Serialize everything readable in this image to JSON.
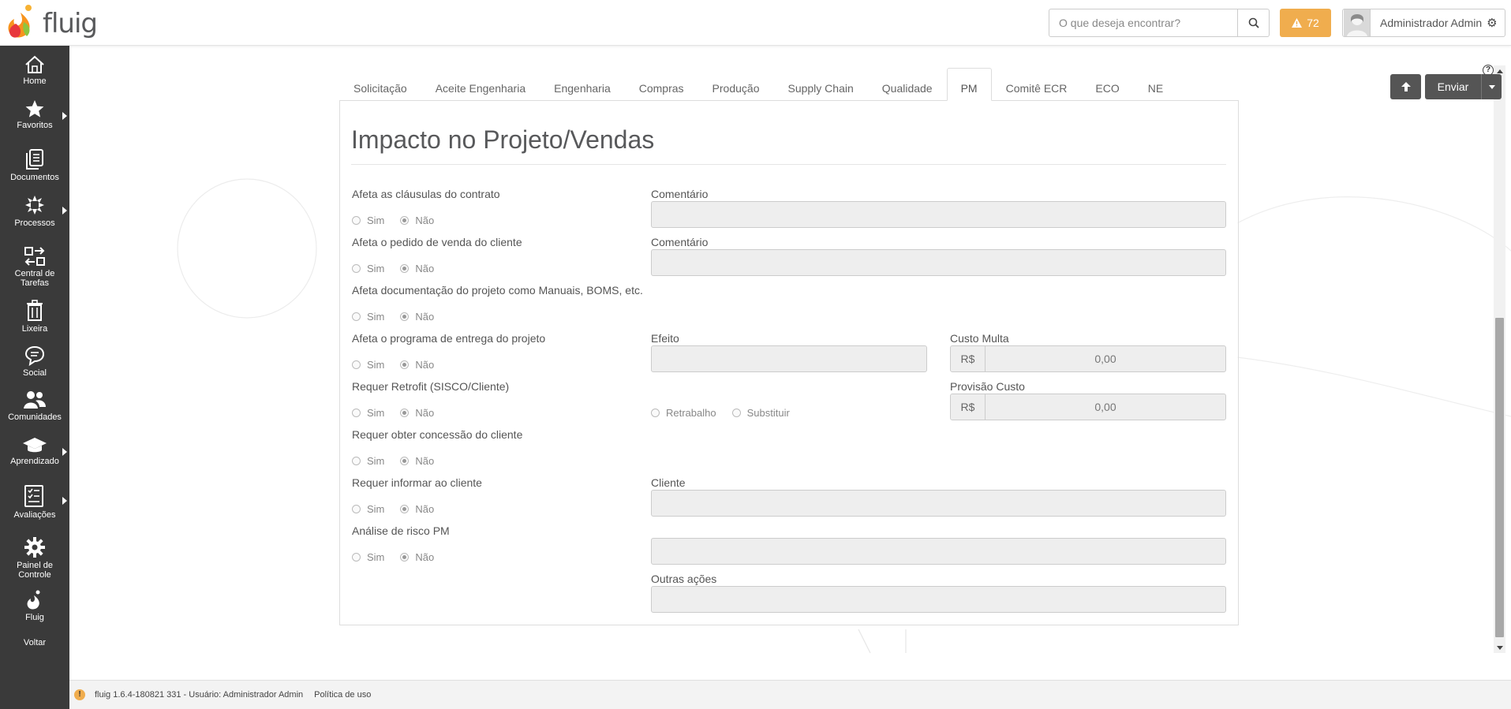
{
  "header": {
    "logo_text": "fluig",
    "search_placeholder": "O que deseja encontrar?",
    "alerts_count": "72",
    "user_name": "Administrador Admin"
  },
  "sidebar": {
    "items": [
      {
        "label": "Home",
        "icon": "home-icon"
      },
      {
        "label": "Favoritos",
        "icon": "star-icon"
      },
      {
        "label": "Documentos",
        "icon": "documents-icon"
      },
      {
        "label": "Processos",
        "icon": "processes-icon"
      },
      {
        "label": "Central de Tarefas",
        "icon": "tasks-icon"
      },
      {
        "label": "Lixeira",
        "icon": "trash-icon"
      },
      {
        "label": "Social",
        "icon": "social-icon"
      },
      {
        "label": "Comunidades",
        "icon": "communities-icon"
      },
      {
        "label": "Aprendizado",
        "icon": "learning-icon"
      },
      {
        "label": "Avaliações",
        "icon": "evaluations-icon"
      },
      {
        "label": "Painel de Controle",
        "icon": "gear-icon"
      },
      {
        "label": "Fluig",
        "icon": "fluig-icon"
      },
      {
        "label": "Voltar",
        "icon": ""
      }
    ]
  },
  "tabs": [
    "Solicitação",
    "Aceite Engenharia",
    "Engenharia",
    "Compras",
    "Produção",
    "Supply Chain",
    "Qualidade",
    "PM",
    "Comitê ECR",
    "ECO",
    "NE"
  ],
  "active_tab": "PM",
  "actions": {
    "send_label": "Enviar",
    "help": "?"
  },
  "form": {
    "title": "Impacto no Projeto/Vendas",
    "radio_yes": "Sim",
    "radio_no": "Não",
    "questions": [
      "Afeta as cláusulas do contrato",
      "Afeta o pedido de venda do cliente",
      "Afeta documentação do projeto como Manuais, BOMS, etc.",
      "Afeta o programa de entrega do projeto",
      "Requer Retrofit (SISCO/Cliente)",
      "Requer obter concessão do cliente",
      "Requer informar ao cliente",
      "Análise de risco PM"
    ],
    "selected": "Não",
    "fields": {
      "comentario_1": "Comentário",
      "comentario_2": "Comentário",
      "efeito": "Efeito",
      "custo_multa": "Custo Multa",
      "provisao_custo": "Provisão Custo",
      "cliente": "Cliente",
      "outras_acoes": "Outras ações",
      "currency": "R$",
      "custo_multa_value": "0,00",
      "provisao_custo_value": "0,00",
      "retrofit_option_1": "Retrabalho",
      "retrofit_option_2": "Substituir"
    }
  },
  "footer": {
    "version_text": "fluig 1.6.4-180821 331 - Usuário: Administrador Admin",
    "policy_link": "Política de uso"
  },
  "colors": {
    "sidebar_bg": "#3a3a3a",
    "alert_bg": "#f0ad4e",
    "action_btn_bg": "#555555"
  }
}
